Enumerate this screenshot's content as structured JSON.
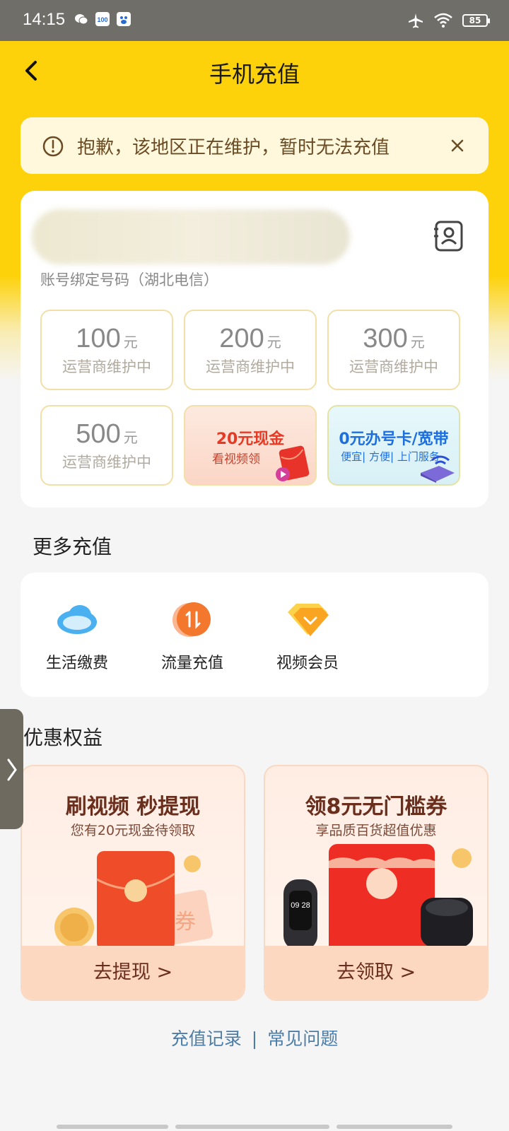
{
  "status_bar": {
    "time": "14:15",
    "battery": "85"
  },
  "header": {
    "title": "手机充值"
  },
  "notice": {
    "text": "抱歉，该地区正在维护，暂时无法充值"
  },
  "account": {
    "subtitle": "账号绑定号码（湖北电信）"
  },
  "amounts": [
    {
      "value": "100",
      "unit": "元",
      "status": "运营商维护中"
    },
    {
      "value": "200",
      "unit": "元",
      "status": "运营商维护中"
    },
    {
      "value": "300",
      "unit": "元",
      "status": "运营商维护中"
    },
    {
      "value": "500",
      "unit": "元",
      "status": "运营商维护中"
    }
  ],
  "promos": [
    {
      "title": "20元现金",
      "subtitle": "看视频领"
    },
    {
      "title": "0元办号卡/宽带",
      "subtitle": "便宜| 方便| 上门服务"
    }
  ],
  "more": {
    "title": "更多充值",
    "items": [
      {
        "label": "生活缴费",
        "icon": "cloud-icon"
      },
      {
        "label": "流量充值",
        "icon": "data-transfer-icon"
      },
      {
        "label": "视频会员",
        "icon": "diamond-icon"
      }
    ]
  },
  "benefits": {
    "title": "优惠权益",
    "cards": [
      {
        "title": "刷视频 秒提现",
        "subtitle": "您有20元现金待领取",
        "button": "去提现 >",
        "side_text": "券"
      },
      {
        "title": "领8元无门槛券",
        "subtitle": "享品质百货超值优惠",
        "button": "去领取 >",
        "watch_text": "09 28"
      }
    ]
  },
  "footer": {
    "records": "充值记录",
    "separator": "|",
    "faq": "常见问题"
  },
  "colors": {
    "brand": "#fdd20a",
    "notice_text": "#6a4b24",
    "link": "#4c7da6"
  }
}
